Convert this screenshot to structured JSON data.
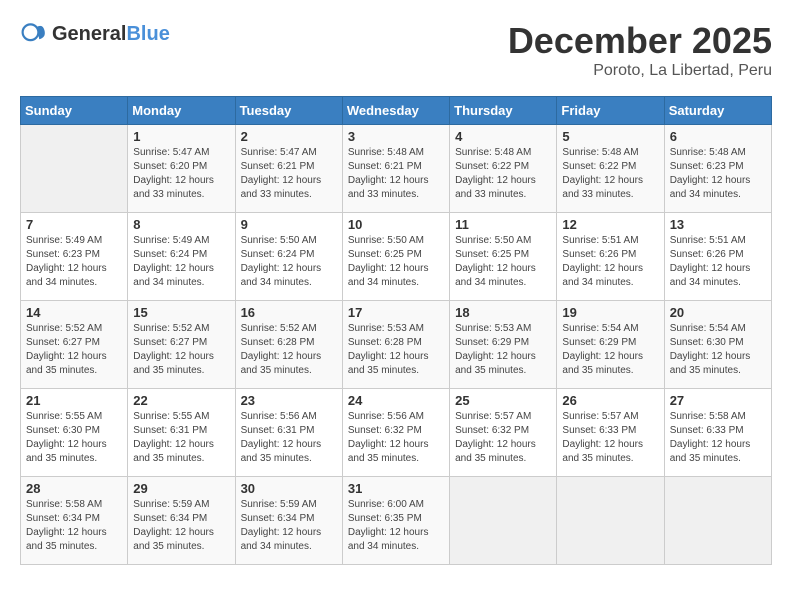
{
  "header": {
    "logo_general": "General",
    "logo_blue": "Blue",
    "month": "December 2025",
    "location": "Poroto, La Libertad, Peru"
  },
  "weekdays": [
    "Sunday",
    "Monday",
    "Tuesday",
    "Wednesday",
    "Thursday",
    "Friday",
    "Saturday"
  ],
  "weeks": [
    [
      {
        "day": "",
        "sunrise": "",
        "sunset": "",
        "daylight": ""
      },
      {
        "day": "1",
        "sunrise": "Sunrise: 5:47 AM",
        "sunset": "Sunset: 6:20 PM",
        "daylight": "Daylight: 12 hours and 33 minutes."
      },
      {
        "day": "2",
        "sunrise": "Sunrise: 5:47 AM",
        "sunset": "Sunset: 6:21 PM",
        "daylight": "Daylight: 12 hours and 33 minutes."
      },
      {
        "day": "3",
        "sunrise": "Sunrise: 5:48 AM",
        "sunset": "Sunset: 6:21 PM",
        "daylight": "Daylight: 12 hours and 33 minutes."
      },
      {
        "day": "4",
        "sunrise": "Sunrise: 5:48 AM",
        "sunset": "Sunset: 6:22 PM",
        "daylight": "Daylight: 12 hours and 33 minutes."
      },
      {
        "day": "5",
        "sunrise": "Sunrise: 5:48 AM",
        "sunset": "Sunset: 6:22 PM",
        "daylight": "Daylight: 12 hours and 33 minutes."
      },
      {
        "day": "6",
        "sunrise": "Sunrise: 5:48 AM",
        "sunset": "Sunset: 6:23 PM",
        "daylight": "Daylight: 12 hours and 34 minutes."
      }
    ],
    [
      {
        "day": "7",
        "sunrise": "Sunrise: 5:49 AM",
        "sunset": "Sunset: 6:23 PM",
        "daylight": "Daylight: 12 hours and 34 minutes."
      },
      {
        "day": "8",
        "sunrise": "Sunrise: 5:49 AM",
        "sunset": "Sunset: 6:24 PM",
        "daylight": "Daylight: 12 hours and 34 minutes."
      },
      {
        "day": "9",
        "sunrise": "Sunrise: 5:50 AM",
        "sunset": "Sunset: 6:24 PM",
        "daylight": "Daylight: 12 hours and 34 minutes."
      },
      {
        "day": "10",
        "sunrise": "Sunrise: 5:50 AM",
        "sunset": "Sunset: 6:25 PM",
        "daylight": "Daylight: 12 hours and 34 minutes."
      },
      {
        "day": "11",
        "sunrise": "Sunrise: 5:50 AM",
        "sunset": "Sunset: 6:25 PM",
        "daylight": "Daylight: 12 hours and 34 minutes."
      },
      {
        "day": "12",
        "sunrise": "Sunrise: 5:51 AM",
        "sunset": "Sunset: 6:26 PM",
        "daylight": "Daylight: 12 hours and 34 minutes."
      },
      {
        "day": "13",
        "sunrise": "Sunrise: 5:51 AM",
        "sunset": "Sunset: 6:26 PM",
        "daylight": "Daylight: 12 hours and 34 minutes."
      }
    ],
    [
      {
        "day": "14",
        "sunrise": "Sunrise: 5:52 AM",
        "sunset": "Sunset: 6:27 PM",
        "daylight": "Daylight: 12 hours and 35 minutes."
      },
      {
        "day": "15",
        "sunrise": "Sunrise: 5:52 AM",
        "sunset": "Sunset: 6:27 PM",
        "daylight": "Daylight: 12 hours and 35 minutes."
      },
      {
        "day": "16",
        "sunrise": "Sunrise: 5:52 AM",
        "sunset": "Sunset: 6:28 PM",
        "daylight": "Daylight: 12 hours and 35 minutes."
      },
      {
        "day": "17",
        "sunrise": "Sunrise: 5:53 AM",
        "sunset": "Sunset: 6:28 PM",
        "daylight": "Daylight: 12 hours and 35 minutes."
      },
      {
        "day": "18",
        "sunrise": "Sunrise: 5:53 AM",
        "sunset": "Sunset: 6:29 PM",
        "daylight": "Daylight: 12 hours and 35 minutes."
      },
      {
        "day": "19",
        "sunrise": "Sunrise: 5:54 AM",
        "sunset": "Sunset: 6:29 PM",
        "daylight": "Daylight: 12 hours and 35 minutes."
      },
      {
        "day": "20",
        "sunrise": "Sunrise: 5:54 AM",
        "sunset": "Sunset: 6:30 PM",
        "daylight": "Daylight: 12 hours and 35 minutes."
      }
    ],
    [
      {
        "day": "21",
        "sunrise": "Sunrise: 5:55 AM",
        "sunset": "Sunset: 6:30 PM",
        "daylight": "Daylight: 12 hours and 35 minutes."
      },
      {
        "day": "22",
        "sunrise": "Sunrise: 5:55 AM",
        "sunset": "Sunset: 6:31 PM",
        "daylight": "Daylight: 12 hours and 35 minutes."
      },
      {
        "day": "23",
        "sunrise": "Sunrise: 5:56 AM",
        "sunset": "Sunset: 6:31 PM",
        "daylight": "Daylight: 12 hours and 35 minutes."
      },
      {
        "day": "24",
        "sunrise": "Sunrise: 5:56 AM",
        "sunset": "Sunset: 6:32 PM",
        "daylight": "Daylight: 12 hours and 35 minutes."
      },
      {
        "day": "25",
        "sunrise": "Sunrise: 5:57 AM",
        "sunset": "Sunset: 6:32 PM",
        "daylight": "Daylight: 12 hours and 35 minutes."
      },
      {
        "day": "26",
        "sunrise": "Sunrise: 5:57 AM",
        "sunset": "Sunset: 6:33 PM",
        "daylight": "Daylight: 12 hours and 35 minutes."
      },
      {
        "day": "27",
        "sunrise": "Sunrise: 5:58 AM",
        "sunset": "Sunset: 6:33 PM",
        "daylight": "Daylight: 12 hours and 35 minutes."
      }
    ],
    [
      {
        "day": "28",
        "sunrise": "Sunrise: 5:58 AM",
        "sunset": "Sunset: 6:34 PM",
        "daylight": "Daylight: 12 hours and 35 minutes."
      },
      {
        "day": "29",
        "sunrise": "Sunrise: 5:59 AM",
        "sunset": "Sunset: 6:34 PM",
        "daylight": "Daylight: 12 hours and 35 minutes."
      },
      {
        "day": "30",
        "sunrise": "Sunrise: 5:59 AM",
        "sunset": "Sunset: 6:34 PM",
        "daylight": "Daylight: 12 hours and 34 minutes."
      },
      {
        "day": "31",
        "sunrise": "Sunrise: 6:00 AM",
        "sunset": "Sunset: 6:35 PM",
        "daylight": "Daylight: 12 hours and 34 minutes."
      },
      {
        "day": "",
        "sunrise": "",
        "sunset": "",
        "daylight": ""
      },
      {
        "day": "",
        "sunrise": "",
        "sunset": "",
        "daylight": ""
      },
      {
        "day": "",
        "sunrise": "",
        "sunset": "",
        "daylight": ""
      }
    ]
  ]
}
